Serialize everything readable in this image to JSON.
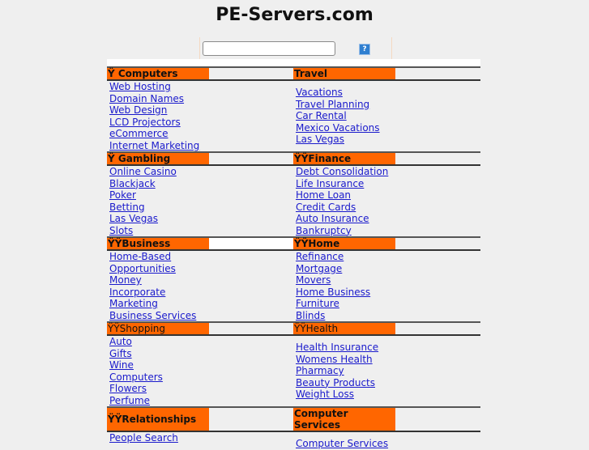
{
  "header": {
    "title": "PE-Servers.com"
  },
  "search": {
    "placeholder": "",
    "value": "",
    "help_label": "?"
  },
  "sections": [
    {
      "left": {
        "title": "Ÿ Computers",
        "links": [
          "Web Hosting",
          "Domain Names",
          "Web Design",
          "LCD Projectors",
          "eCommerce",
          "Internet Marketing"
        ]
      },
      "right": {
        "title": " Travel",
        "links": [
          "Vacations",
          "Travel Planning",
          "Car Rental",
          "Mexico Vacations",
          "Las Vegas"
        ]
      }
    },
    {
      "left": {
        "title": "Ÿ Gambling",
        "links": [
          "Online Casino",
          "Blackjack",
          "Poker",
          "Betting",
          "Las Vegas",
          "Slots"
        ]
      },
      "right": {
        "title": "ŸŸFinance",
        "links": [
          "Debt Consolidation",
          "Life Insurance",
          "Home Loan",
          "Credit Cards",
          "Auto Insurance",
          "Bankruptcy"
        ]
      }
    },
    {
      "left": {
        "title": "ŸŸBusiness",
        "links": [
          "Home-Based",
          "Opportunities",
          "Money",
          "Incorporate",
          "Marketing",
          "Business Services"
        ]
      },
      "right": {
        "title": "ŸŸHome",
        "links": [
          "Refinance ",
          "Mortgage ",
          "Movers ",
          "Home Business ",
          "Furniture ",
          "Blinds"
        ]
      }
    },
    {
      "left": {
        "title": "ŸŸShopping",
        "links": [
          "Auto",
          "Gifts",
          "Wine",
          "Computers",
          "Flowers",
          "Perfume"
        ]
      },
      "right": {
        "title": "ŸŸHealth",
        "links": [
          "Health Insurance",
          "Womens Health",
          "Pharmacy",
          "Beauty Products",
          "Weight Loss"
        ]
      }
    },
    {
      "left": {
        "title": "ŸŸRelationships",
        "links": [
          "People Search"
        ]
      },
      "right": {
        "title": " Computer Services",
        "links": [
          "Computer Services"
        ]
      }
    }
  ],
  "colors": {
    "category_bg": "#ff6600",
    "link": "#1a1acc",
    "page_bg": "#efefef"
  }
}
